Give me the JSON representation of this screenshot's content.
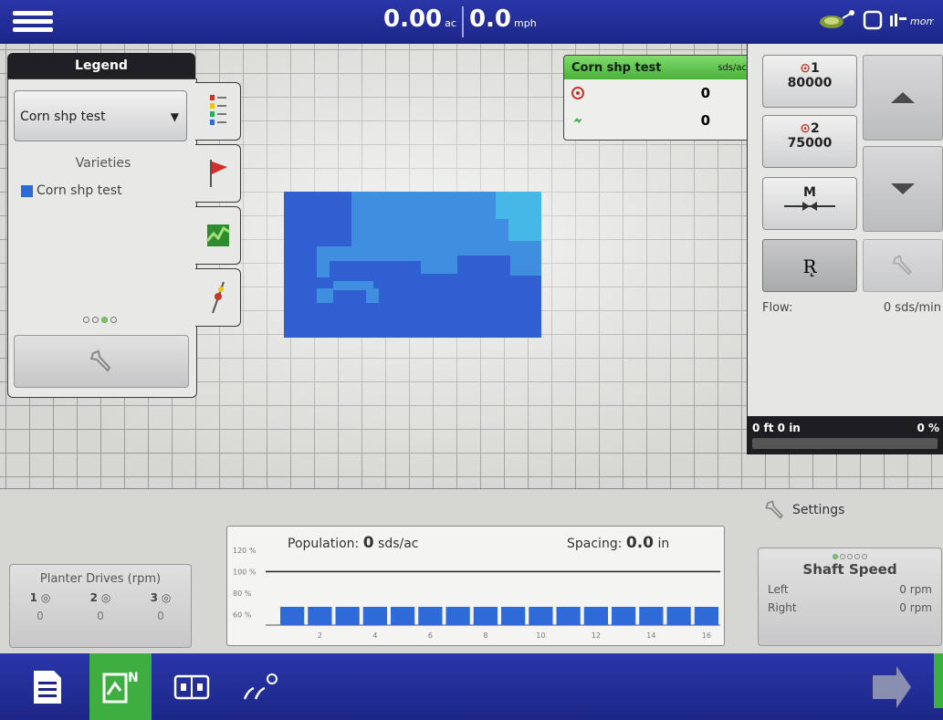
{
  "top": {
    "area_value": "0.00",
    "area_unit": "ac",
    "speed_value": "0.0",
    "speed_unit": "mph",
    "icons": [
      "menu-icon",
      "gps-antenna-icon",
      "screen-icon",
      "signal-strength-icon"
    ]
  },
  "legend": {
    "tab_label": "Legend",
    "dropdown_value": "Corn shp test",
    "varieties_title": "Varieties",
    "variety_name": "Corn shp test",
    "variety_color": "#2f6bd8",
    "page_dots_active_index": 2,
    "side_tabs": [
      "legend-list-icon",
      "flag-icon",
      "field-map-icon",
      "tool-icon"
    ]
  },
  "product": {
    "name": "Corn shp test",
    "unit": "sds/ac",
    "target_rate": "0",
    "applied_rate": "0"
  },
  "rates": {
    "rate1_label": "1",
    "rate1_value": "80000",
    "rate2_label": "2",
    "rate2_value": "75000",
    "manual_label": "M",
    "rx_label": "R̨",
    "flow_label": "Flow:",
    "flow_value": "0 sds/min"
  },
  "progress": {
    "left_text": "0 ft 0 in",
    "right_text": "0 %"
  },
  "settings_label": "Settings",
  "planter": {
    "title": "Planter Drives (rpm)",
    "drives": [
      {
        "num": "1",
        "value": "0"
      },
      {
        "num": "2",
        "value": "0"
      },
      {
        "num": "3",
        "value": "0"
      }
    ]
  },
  "population": {
    "pop_label": "Population:",
    "pop_value": "0",
    "pop_unit": "sds/ac",
    "spacing_label": "Spacing:",
    "spacing_value": "0.0",
    "spacing_unit": "in"
  },
  "chart_data": {
    "type": "bar",
    "title": "",
    "xlabel": "",
    "ylabel": "",
    "y_ticks": [
      "120 %",
      "100 %",
      "80 %",
      "60 %"
    ],
    "x_tick_labels": [
      "2",
      "4",
      "6",
      "8",
      "10",
      "12",
      "14",
      "16"
    ],
    "categories": [
      "1",
      "2",
      "3",
      "4",
      "5",
      "6",
      "7",
      "8",
      "9",
      "10",
      "11",
      "12",
      "13",
      "14",
      "15",
      "16"
    ],
    "values": [
      60,
      60,
      60,
      60,
      60,
      60,
      60,
      60,
      60,
      60,
      60,
      60,
      60,
      60,
      60,
      60
    ],
    "reference_line": 100,
    "ylim": [
      50,
      125
    ],
    "bar_color": "#2f6bd8",
    "grid": false
  },
  "shaft": {
    "title": "Shaft Speed",
    "left_label": "Left",
    "left_value": "0 rpm",
    "right_label": "Right",
    "right_value": "0 rpm",
    "dots_active_index": 0
  },
  "colors": {
    "header_blue": "#1c2688",
    "field_dark": "#2f5fd0",
    "field_mid": "#3f8ee0",
    "field_light": "#45b8e6",
    "accent_green": "#4cb03a"
  },
  "bottom_bar": {
    "buttons": [
      "report-icon",
      "field-map-nav-icon",
      "split-view-icon",
      "planting-icon",
      "next-screen-icon"
    ]
  }
}
